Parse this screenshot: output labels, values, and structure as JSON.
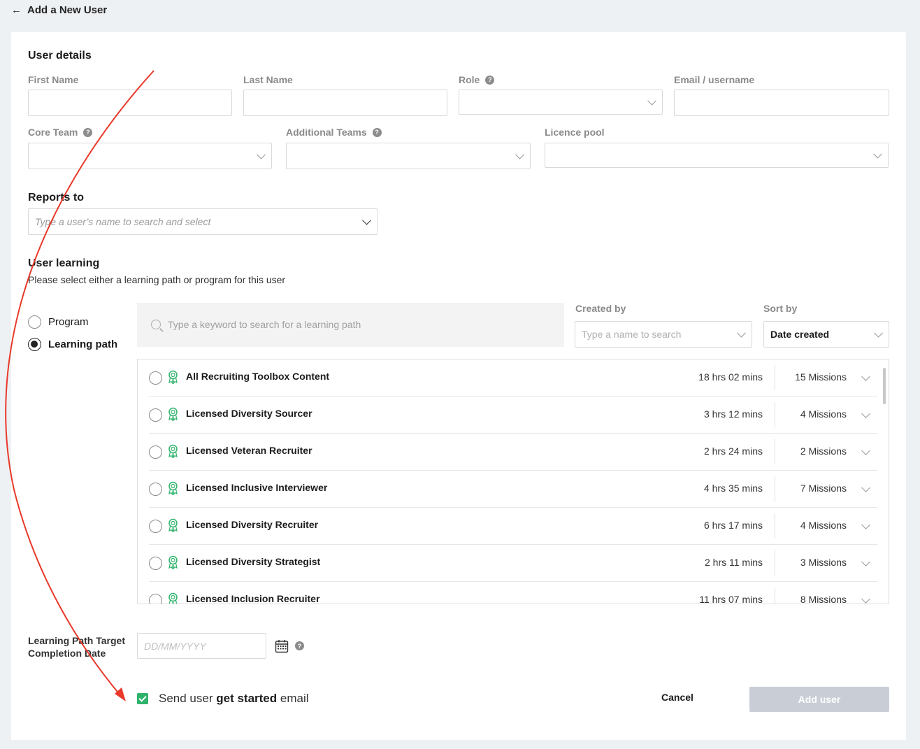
{
  "header": {
    "back_icon": "arrow-left-icon",
    "title": "Add a New User"
  },
  "user_details": {
    "heading": "User details",
    "first_name": {
      "label": "First Name",
      "value": ""
    },
    "last_name": {
      "label": "Last Name",
      "value": ""
    },
    "role": {
      "label": "Role",
      "help": "?",
      "value": ""
    },
    "email": {
      "label": "Email / username",
      "value": ""
    },
    "core_team": {
      "label": "Core Team",
      "help": "?",
      "value": ""
    },
    "additional_teams": {
      "label": "Additional Teams",
      "help": "?",
      "value": ""
    },
    "licence_pool": {
      "label": "Licence pool",
      "value": ""
    }
  },
  "reports_to": {
    "heading": "Reports to",
    "placeholder": "Type a user’s name to search and select"
  },
  "user_learning": {
    "heading": "User learning",
    "subtext": "Please select either a learning path or program for this user",
    "options": [
      {
        "label": "Program",
        "selected": false
      },
      {
        "label": "Learning path",
        "selected": true
      }
    ],
    "search_placeholder": "Type a keyword to search for a learning path",
    "created_by": {
      "label": "Created by",
      "placeholder": "Type a name to search"
    },
    "sort_by": {
      "label": "Sort by",
      "value": "Date created"
    },
    "paths": [
      {
        "title": "All Recruiting Toolbox Content",
        "duration": "18 hrs 02 mins",
        "missions": "15 Missions"
      },
      {
        "title": "Licensed Diversity Sourcer",
        "duration": "3 hrs 12 mins",
        "missions": "4 Missions"
      },
      {
        "title": "Licensed Veteran Recruiter",
        "duration": "2 hrs 24 mins",
        "missions": "2 Missions"
      },
      {
        "title": "Licensed Inclusive Interviewer",
        "duration": "4 hrs 35 mins",
        "missions": "7 Missions"
      },
      {
        "title": "Licensed Diversity Recruiter",
        "duration": "6 hrs 17 mins",
        "missions": "4 Missions"
      },
      {
        "title": "Licensed Diversity Strategist",
        "duration": "2 hrs 11 mins",
        "missions": "3 Missions"
      },
      {
        "title": "Licensed Inclusion Recruiter",
        "duration": "11 hrs 07 mins",
        "missions": "8 Missions"
      }
    ]
  },
  "completion_date": {
    "label": "Learning Path Target Completion Date",
    "placeholder": "DD/MM/YYYY",
    "help": "?"
  },
  "footer": {
    "checkbox_checked": true,
    "email_text_pre": "Send user ",
    "email_text_bold": "get started",
    "email_text_post": " email",
    "cancel_label": "Cancel",
    "add_user_label": "Add user"
  },
  "colors": {
    "accent_green": "#2fb36b",
    "disabled_button": "#c9ced6",
    "annotation_red": "#e8392a"
  }
}
